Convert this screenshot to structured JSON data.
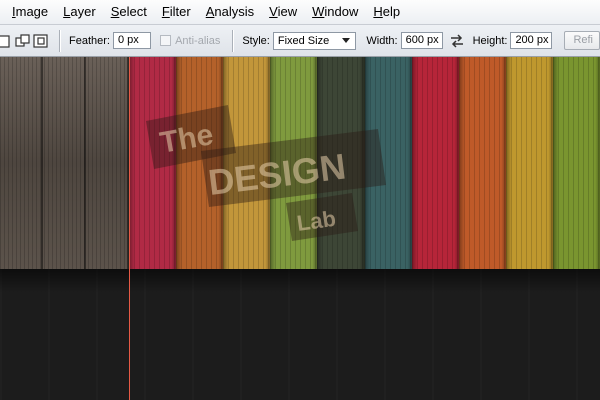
{
  "menu": [
    {
      "mnemonic": "I",
      "rest": "mage"
    },
    {
      "mnemonic": "L",
      "rest": "ayer"
    },
    {
      "mnemonic": "S",
      "rest": "elect"
    },
    {
      "mnemonic": "F",
      "rest": "ilter"
    },
    {
      "mnemonic": "A",
      "rest": "nalysis"
    },
    {
      "mnemonic": "V",
      "rest": "iew"
    },
    {
      "mnemonic": "W",
      "rest": "indow"
    },
    {
      "mnemonic": "H",
      "rest": "elp"
    }
  ],
  "options": {
    "feather_label": "Feather:",
    "feather_value": "0 px",
    "antialias_label": "Anti-alias",
    "style_label": "Style:",
    "style_value": "Fixed Size",
    "width_label": "Width:",
    "width_value": "600 px",
    "height_label": "Height:",
    "height_value": "200 px",
    "refine_label": "Refi"
  },
  "canvas": {
    "stripe_colors": [
      "#b12a45",
      "#b4612a",
      "#c2963a",
      "#7f9a3e",
      "#3d4636",
      "#3a6263",
      "#b62539",
      "#bf5a29",
      "#bf982e",
      "#7a952f"
    ],
    "guide_color": "#e65a45",
    "watermark": {
      "line1": "The",
      "line2": "DESIGN",
      "line3": "Lab"
    }
  }
}
